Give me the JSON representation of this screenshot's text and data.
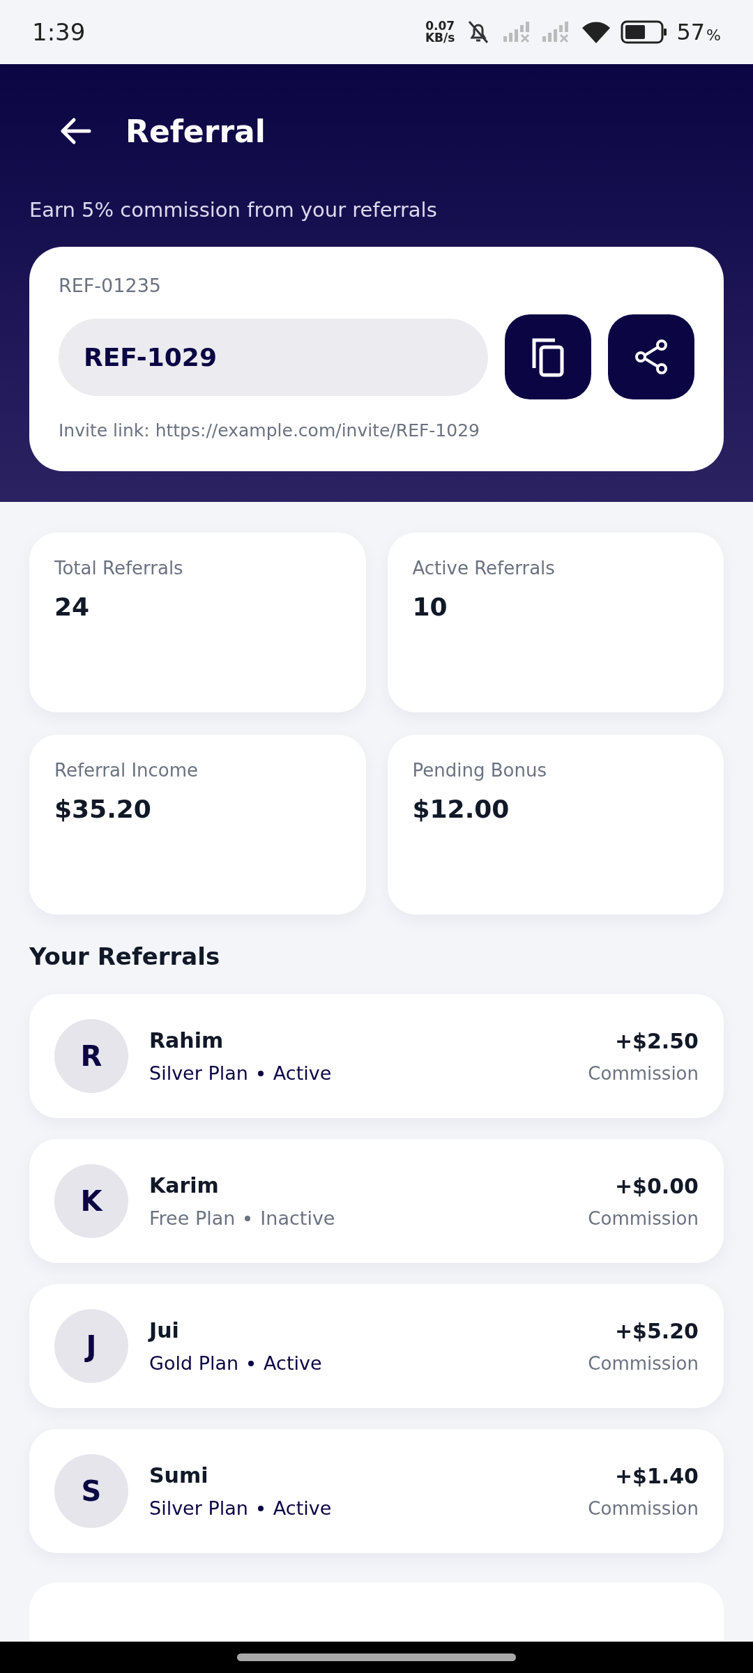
{
  "status_bar": {
    "time": "1:39",
    "net_speed_value": "0.07",
    "net_speed_unit": "KB/s",
    "battery": "57",
    "battery_unit": "%"
  },
  "header": {
    "title": "Referral",
    "subtitle": "Earn 5% commission from your referrals"
  },
  "code_card": {
    "label": "REF-01235",
    "code": "REF-1029",
    "invite_link": "Invite link: https://example.com/invite/REF-1029"
  },
  "stats": [
    {
      "label": "Total Referrals",
      "value": "24"
    },
    {
      "label": "Active Referrals",
      "value": "10"
    },
    {
      "label": "Referral Income",
      "value": "$35.20"
    },
    {
      "label": "Pending Bonus",
      "value": "$12.00"
    }
  ],
  "referrals_title": "Your Referrals",
  "referrals": [
    {
      "initial": "R",
      "name": "Rahim",
      "plan": "Silver Plan",
      "status": "Active",
      "active": true,
      "amount": "+$2.50",
      "amount_label": "Commission"
    },
    {
      "initial": "K",
      "name": "Karim",
      "plan": "Free Plan",
      "status": "Inactive",
      "active": false,
      "amount": "+$0.00",
      "amount_label": "Commission"
    },
    {
      "initial": "J",
      "name": "Jui",
      "plan": "Gold Plan",
      "status": "Active",
      "active": true,
      "amount": "+$5.20",
      "amount_label": "Commission"
    },
    {
      "initial": "S",
      "name": "Sumi",
      "plan": "Silver Plan",
      "status": "Active",
      "active": true,
      "amount": "+$1.40",
      "amount_label": "Commission"
    }
  ]
}
